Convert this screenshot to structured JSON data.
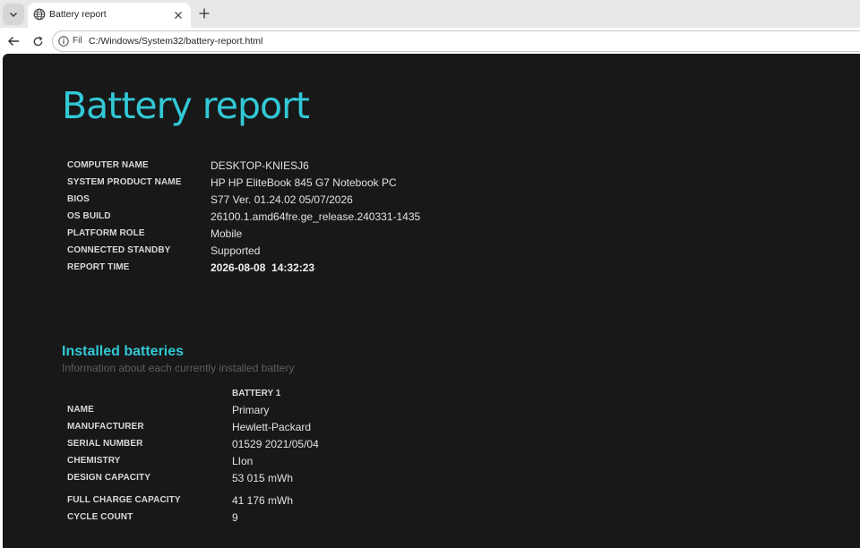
{
  "browser": {
    "tab_title": "Battery report",
    "address_scheme": "Fil",
    "url": "C:/Windows/System32/battery-report.html"
  },
  "report": {
    "title": "Battery report",
    "system_info": [
      {
        "key": "COMPUTER NAME",
        "value": "DESKTOP-KNIESJ6"
      },
      {
        "key": "SYSTEM PRODUCT NAME",
        "value": "HP HP EliteBook 845 G7 Notebook PC"
      },
      {
        "key": "BIOS",
        "value": "S77 Ver. 01.24.02 05/07/2026"
      },
      {
        "key": "OS BUILD",
        "value": "26100.1.amd64fre.ge_release.240331-1435"
      },
      {
        "key": "PLATFORM ROLE",
        "value": "Mobile"
      },
      {
        "key": "CONNECTED STANDBY",
        "value": "Supported"
      },
      {
        "key": "REPORT TIME",
        "value": "2026-08-08  14:32:23"
      }
    ],
    "installed": {
      "title": "Installed batteries",
      "subtitle": "Information about each currently installed battery",
      "column": "BATTERY 1",
      "rows": [
        {
          "key": "NAME",
          "value": "Primary"
        },
        {
          "key": "MANUFACTURER",
          "value": "Hewlett-Packard"
        },
        {
          "key": "SERIAL NUMBER",
          "value": "01529 2021/05/04"
        },
        {
          "key": "CHEMISTRY",
          "value": "LIon"
        },
        {
          "key": "DESIGN CAPACITY",
          "value": "53 015 mWh"
        },
        {
          "key": "FULL CHARGE CAPACITY",
          "value": "41 176 mWh"
        },
        {
          "key": "CYCLE COUNT",
          "value": "9"
        }
      ]
    }
  },
  "colors": {
    "accent": "#32c8d6",
    "page_background": "#181818",
    "chrome_background": "#e8e8e8"
  }
}
